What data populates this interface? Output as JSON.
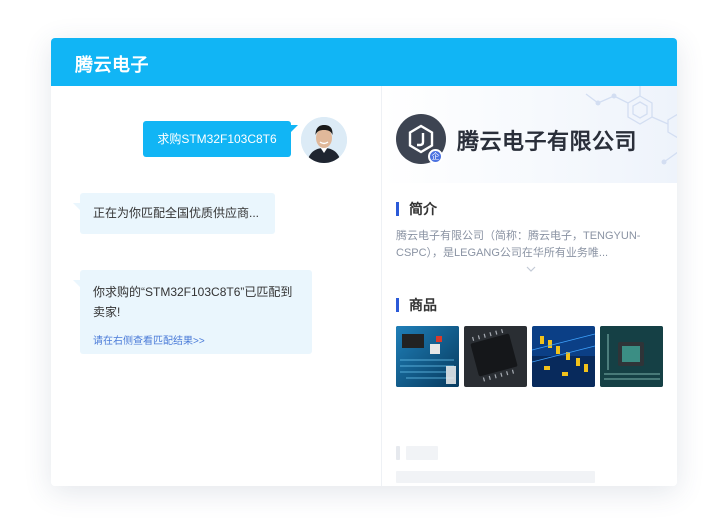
{
  "header": {
    "title": "腾云电子"
  },
  "chat": {
    "outgoing_message": "求购STM32F103C8T6",
    "incoming_messages": [
      {
        "text": "正在为你匹配全国优质供应商..."
      },
      {
        "text": "你求购的“STM32F103C8T6”已匹配到卖家!",
        "link": "请在右侧查看匹配结果>>"
      }
    ]
  },
  "company": {
    "name": "腾云电子有限公司",
    "badge": "企",
    "intro": {
      "title": "简介",
      "text": "腾云电子有限公司（简称：腾云电子，TENGYUN-CSPC），是LEGANG公司在华所有业务唯..."
    },
    "goods": {
      "title": "商品",
      "items": [
        {
          "name": "circuit-board-blue"
        },
        {
          "name": "chip-dark"
        },
        {
          "name": "circuit-board-yellow"
        },
        {
          "name": "chip-teal"
        }
      ]
    }
  },
  "colors": {
    "header": "#11b5f5",
    "accent": "#2b5ad8",
    "bubble_in": "#eaf6fd"
  }
}
